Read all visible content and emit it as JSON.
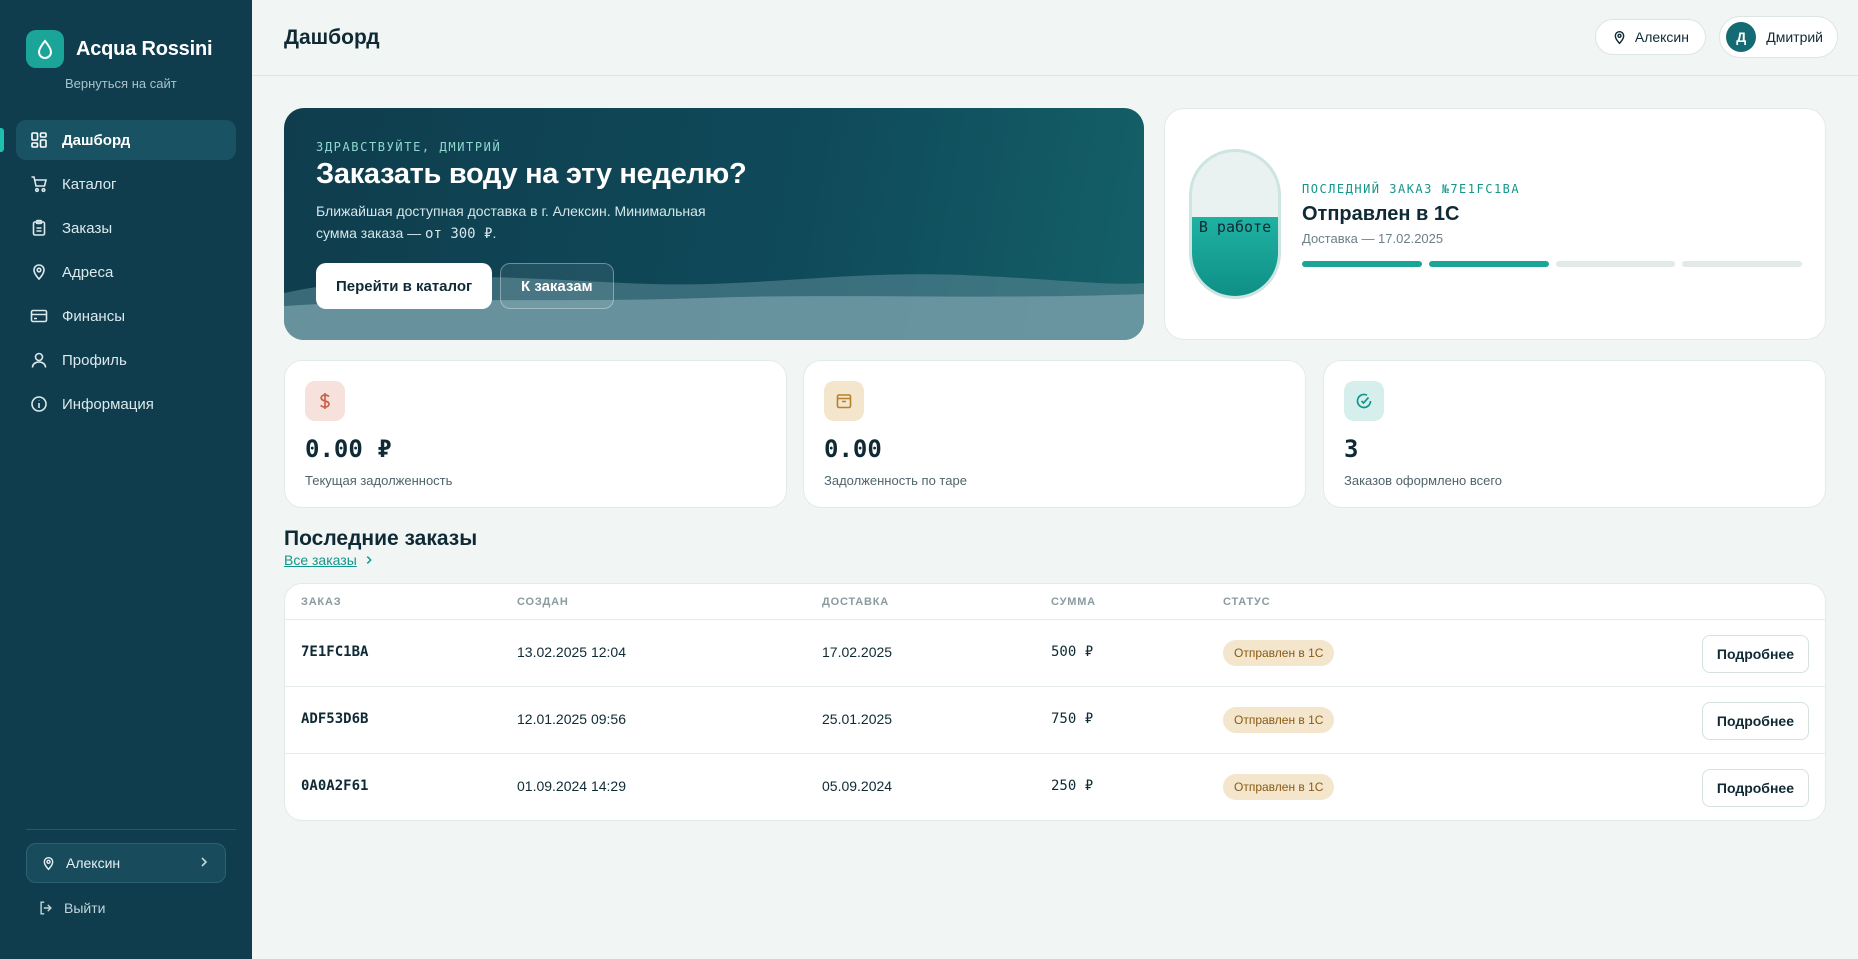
{
  "brand": {
    "name": "Acqua Rossini",
    "back_link": "Вернуться на сайт"
  },
  "nav": [
    {
      "label": "Дашборд",
      "icon": "dashboard-icon",
      "active": true
    },
    {
      "label": "Каталог",
      "icon": "cart-icon",
      "active": false
    },
    {
      "label": "Заказы",
      "icon": "clipboard-icon",
      "active": false
    },
    {
      "label": "Адреса",
      "icon": "map-pin-icon",
      "active": false
    },
    {
      "label": "Финансы",
      "icon": "credit-card-icon",
      "active": false
    },
    {
      "label": "Профиль",
      "icon": "user-icon",
      "active": false
    },
    {
      "label": "Информация",
      "icon": "info-icon",
      "active": false
    }
  ],
  "sidebar_footer": {
    "city": "Алексин",
    "logout": "Выйти"
  },
  "header": {
    "title": "Дашборд",
    "city": "Алексин",
    "user_name": "Дмитрий",
    "user_initial": "Д"
  },
  "hero": {
    "eyebrow": "ЗДРАВСТВУЙТЕ, ДМИТРИЙ",
    "title": "Заказать воду на эту неделю?",
    "text_line1": "Ближайшая доступная доставка в г. Алексин. Минимальная",
    "text_line2_prefix": "сумма заказа — ",
    "text_line2_amount": "от 300 ₽",
    "text_line2_suffix": ".",
    "primary_button": "Перейти в каталог",
    "secondary_button": "К заказам"
  },
  "last_order": {
    "capsule_label": "В работе",
    "capsule_level": 0.55,
    "eyebrow": "ПОСЛЕДНИЙ ЗАКАЗ №7E1FC1BA",
    "status": "Отправлен в 1С",
    "delivery": "Доставка — 17.02.2025",
    "progress_steps_total": 4,
    "progress_steps_done": 2
  },
  "stats": [
    {
      "value": "0.00 ₽",
      "label": "Текущая задолженность",
      "icon": "dollar-icon",
      "color": "#f6e1dc",
      "icon_color": "#c9624a"
    },
    {
      "value": "0.00",
      "label": "Задолженность по таре",
      "icon": "box-icon",
      "color": "#f3e6cc",
      "icon_color": "#b7802a"
    },
    {
      "value": "3",
      "label": "Заказов оформлено всего",
      "icon": "check-circle-icon",
      "color": "#d6efec",
      "icon_color": "#13968a"
    }
  ],
  "recent_orders": {
    "title": "Последние заказы",
    "all_link": "Все заказы",
    "columns": [
      "ЗАКАЗ",
      "СОЗДАН",
      "ДОСТАВКА",
      "СУММА",
      "СТАТУС"
    ],
    "detail_button": "Подробнее",
    "rows": [
      {
        "code": "7E1FC1BA",
        "created": "13.02.2025 12:04",
        "delivery": "17.02.2025",
        "sum": "500 ₽",
        "status": "Отправлен в 1С"
      },
      {
        "code": "ADF53D6B",
        "created": "12.01.2025 09:56",
        "delivery": "25.01.2025",
        "sum": "750 ₽",
        "status": "Отправлен в 1С"
      },
      {
        "code": "0A0A2F61",
        "created": "01.09.2024 14:29",
        "delivery": "05.09.2024",
        "sum": "250 ₽",
        "status": "Отправлен в 1С"
      }
    ]
  },
  "colors": {
    "sidebar": "#0f3d4d",
    "accent": "#1aa598",
    "badge_bg": "#f3e6cc"
  }
}
